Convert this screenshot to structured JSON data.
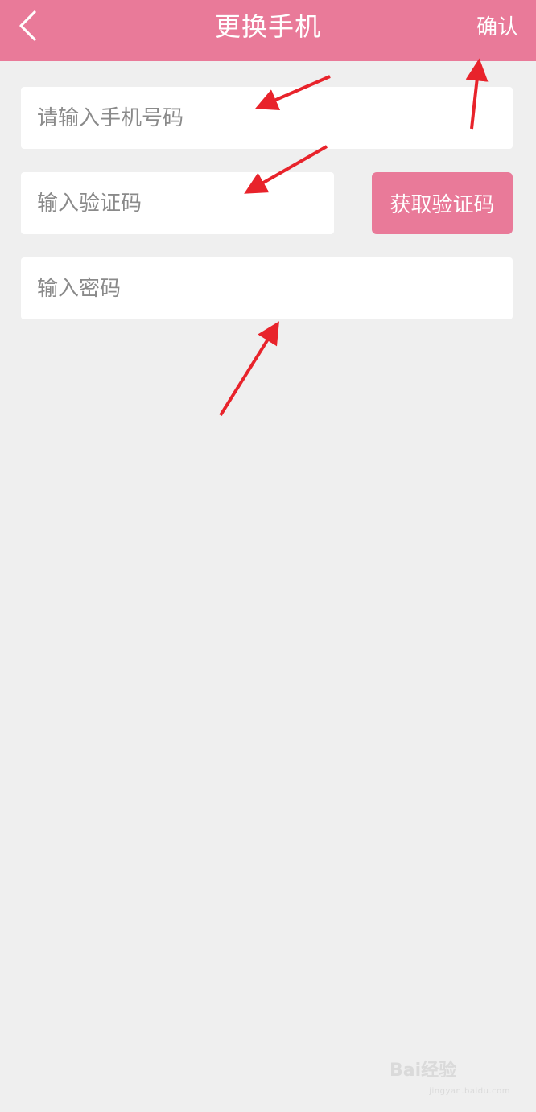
{
  "header": {
    "title": "更换手机",
    "confirm_label": "确认",
    "back_icon": "chevron-left-icon"
  },
  "form": {
    "phone_placeholder": "请输入手机号码",
    "code_placeholder": "输入验证码",
    "password_placeholder": "输入密码",
    "get_code_label": "获取验证码"
  },
  "watermark": {
    "brand": "Bai经验",
    "sub": "jingyan.baidu.com"
  },
  "colors": {
    "accent": "#e97a99",
    "background": "#efefef",
    "annotation": "#e8232b"
  }
}
